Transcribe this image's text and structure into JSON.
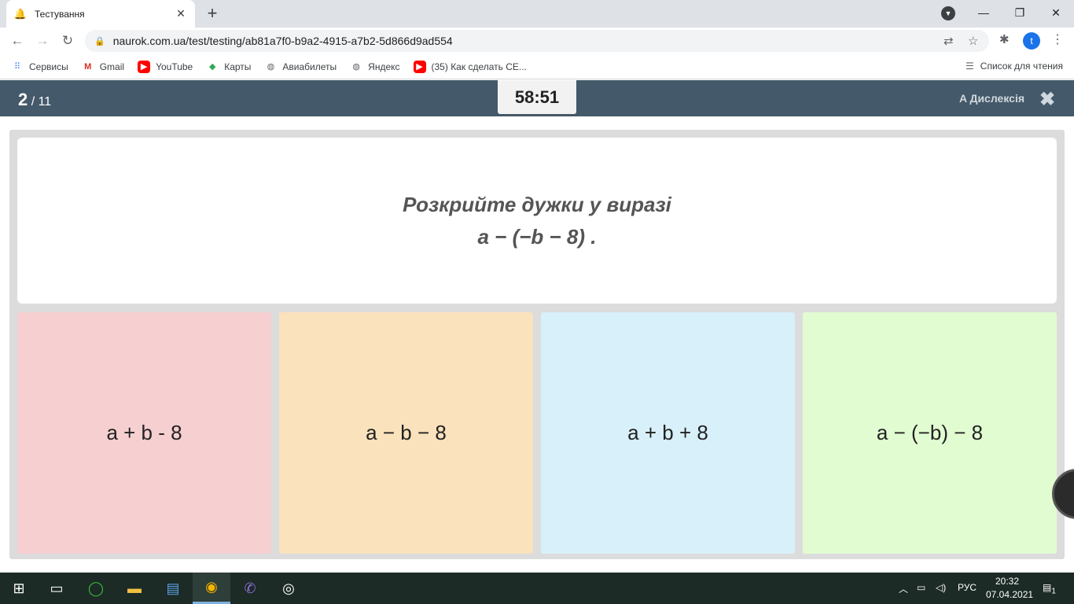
{
  "browser": {
    "tab_title": "Тестування",
    "url": "naurok.com.ua/test/testing/ab81a7f0-b9a2-4915-a7b2-5d866d9ad554",
    "avatar_letter": "t",
    "bookmarks": [
      "Сервисы",
      "Gmail",
      "YouTube",
      "Карты",
      "Авиабилеты",
      "Яндекс",
      "(35) Как сделать CE..."
    ],
    "reading_list": "Список для чтения"
  },
  "header": {
    "current": "2",
    "total": "/ 11",
    "timer": "58:51",
    "dyslexia_label": "A Дислексія"
  },
  "question": {
    "line1": "Розкрийте дужки у виразі",
    "line2": "a − (−b − 8) ."
  },
  "answers": [
    {
      "text": "a + b - 8",
      "color": "#f6cfd1"
    },
    {
      "text": "a − b − 8",
      "color": "#fae2bd"
    },
    {
      "text": "a + b + 8",
      "color": "#d8f0fa"
    },
    {
      "text": "a − (−b) − 8",
      "color": "#e2fcd2"
    }
  ],
  "taskbar": {
    "lang": "РУС",
    "time": "20:32",
    "date": "07.04.2021",
    "notification_count": "1"
  }
}
